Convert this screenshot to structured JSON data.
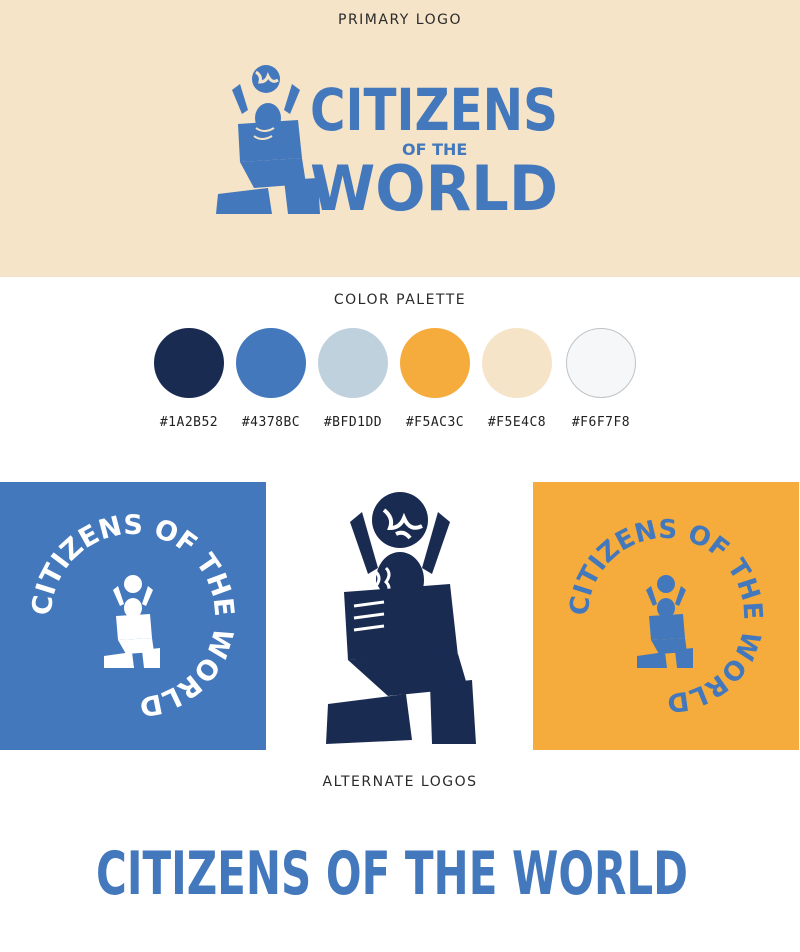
{
  "sections": {
    "primary_label": "PRIMARY LOGO",
    "palette_label": "COLOR PALETTE",
    "alternate_label": "ALTERNATE LOGOS"
  },
  "logo": {
    "line1": "CITIZENS",
    "of_the": "OF THE",
    "line2": "WORLD",
    "circular": "CITIZENS OF THE WORLD",
    "wordmark": "CITIZENS OF THE WORLD"
  },
  "palette": [
    {
      "hex": "#1A2B52",
      "color": "#1A2B52"
    },
    {
      "hex": "#4378BC",
      "color": "#4378BC"
    },
    {
      "hex": "#BFD1DD",
      "color": "#BFD1DD"
    },
    {
      "hex": "#F5AC3C",
      "color": "#F5AC3C"
    },
    {
      "hex": "#F5E4C8",
      "color": "#F5E4C8"
    },
    {
      "hex": "#F6F7F8",
      "color": "#F6F7F8"
    }
  ],
  "colors": {
    "navy": "#1A2B52",
    "blue": "#4378BC",
    "orange": "#F5AC3C",
    "cream": "#F5E4C8",
    "white": "#FFFFFF"
  }
}
